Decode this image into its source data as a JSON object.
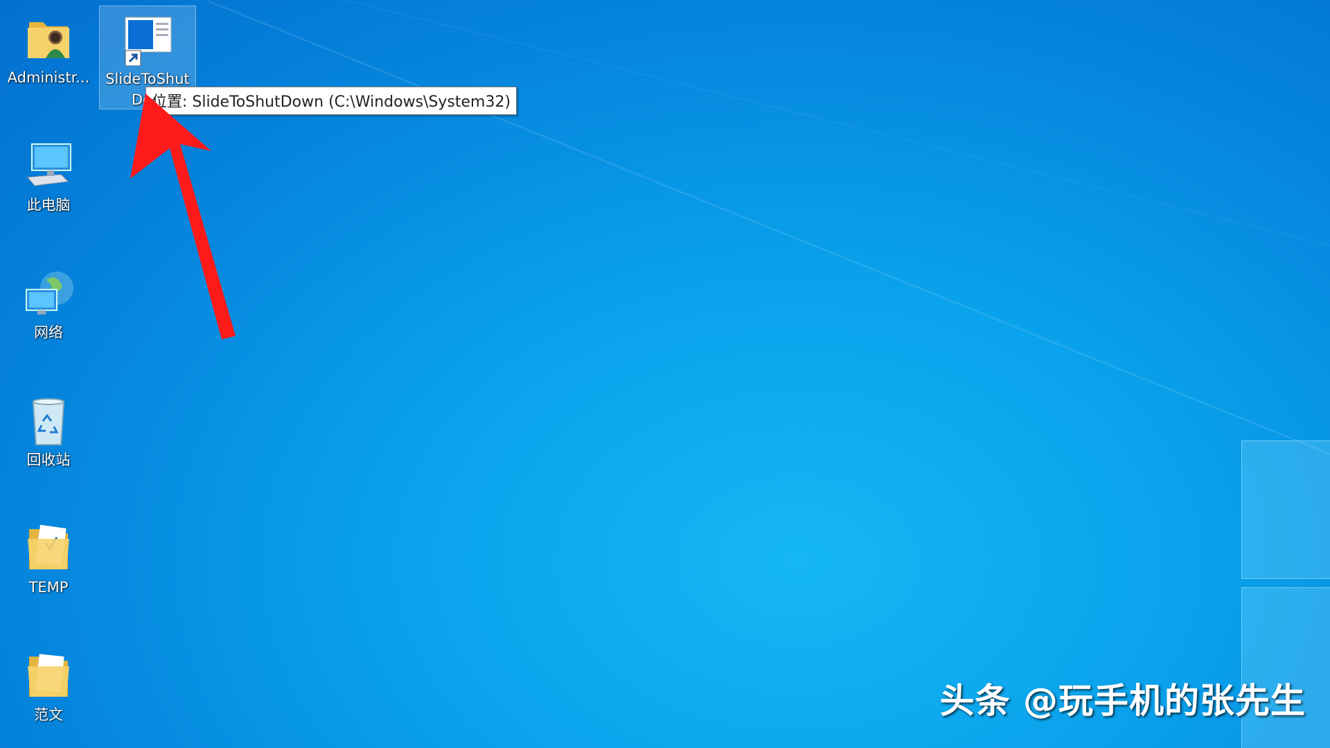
{
  "desktop_icons": [
    {
      "label": "Administr...",
      "icon": "user-folder-icon"
    },
    {
      "label": "SlideToShut\nDow",
      "icon": "shortcut-app-icon"
    },
    {
      "label": "此电脑",
      "icon": "computer-icon"
    },
    {
      "label": "网络",
      "icon": "network-icon"
    },
    {
      "label": "回收站",
      "icon": "recycle-bin-icon"
    },
    {
      "label": "TEMP",
      "icon": "folder-icon"
    },
    {
      "label": "范文",
      "icon": "folder-icon"
    }
  ],
  "tooltip": {
    "text": "位置: SlideToShutDown (C:\\Windows\\System32)"
  },
  "watermark": {
    "text": "头条 @玩手机的张先生"
  },
  "colors": {
    "arrow": "#ff1a1a",
    "desktop": "#0a9fea",
    "folder": "#f4cf5e"
  }
}
